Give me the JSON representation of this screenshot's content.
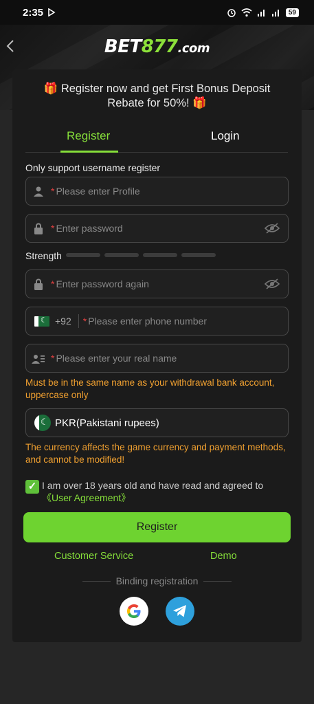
{
  "status": {
    "time": "2:35",
    "battery": "59"
  },
  "brand": {
    "logo_a": "BET",
    "logo_b": "877",
    "logo_c": ".com"
  },
  "promo": {
    "line1": "Register now and get First Bonus Deposit",
    "line2": "Rebate for 50%!"
  },
  "tabs": {
    "register": "Register",
    "login": "Login"
  },
  "form": {
    "note": "Only support username register",
    "profile_placeholder": "Please enter Profile",
    "password_placeholder": "Enter password",
    "strength_label": "Strength",
    "password_again_placeholder": "Enter password again",
    "country_code": "+92",
    "phone_placeholder": "Please enter phone number",
    "realname_placeholder": "Please enter your real name",
    "realname_warning": "Must be in the same name as your withdrawal bank account, uppercase only",
    "currency_value": "PKR(Pakistani rupees)",
    "currency_warning": "The currency affects the game currency and payment methods, and cannot be modified!",
    "agree_text": "I am over 18 years old and have read and agreed to ",
    "agree_link": "《User Agreement》",
    "required_mark": "*"
  },
  "actions": {
    "register_button": "Register",
    "customer_service": "Customer Service",
    "demo": "Demo",
    "binding": "Binding registration"
  },
  "icons": [
    "back-chevron-icon",
    "user-icon",
    "lock-icon",
    "eye-off-icon",
    "pk-flag-icon",
    "id-card-icon",
    "check-icon",
    "google-icon",
    "telegram-icon"
  ],
  "colors": {
    "accent": "#86df3a",
    "button": "#6ed330",
    "warning": "#f0a030",
    "required": "#e04040"
  }
}
